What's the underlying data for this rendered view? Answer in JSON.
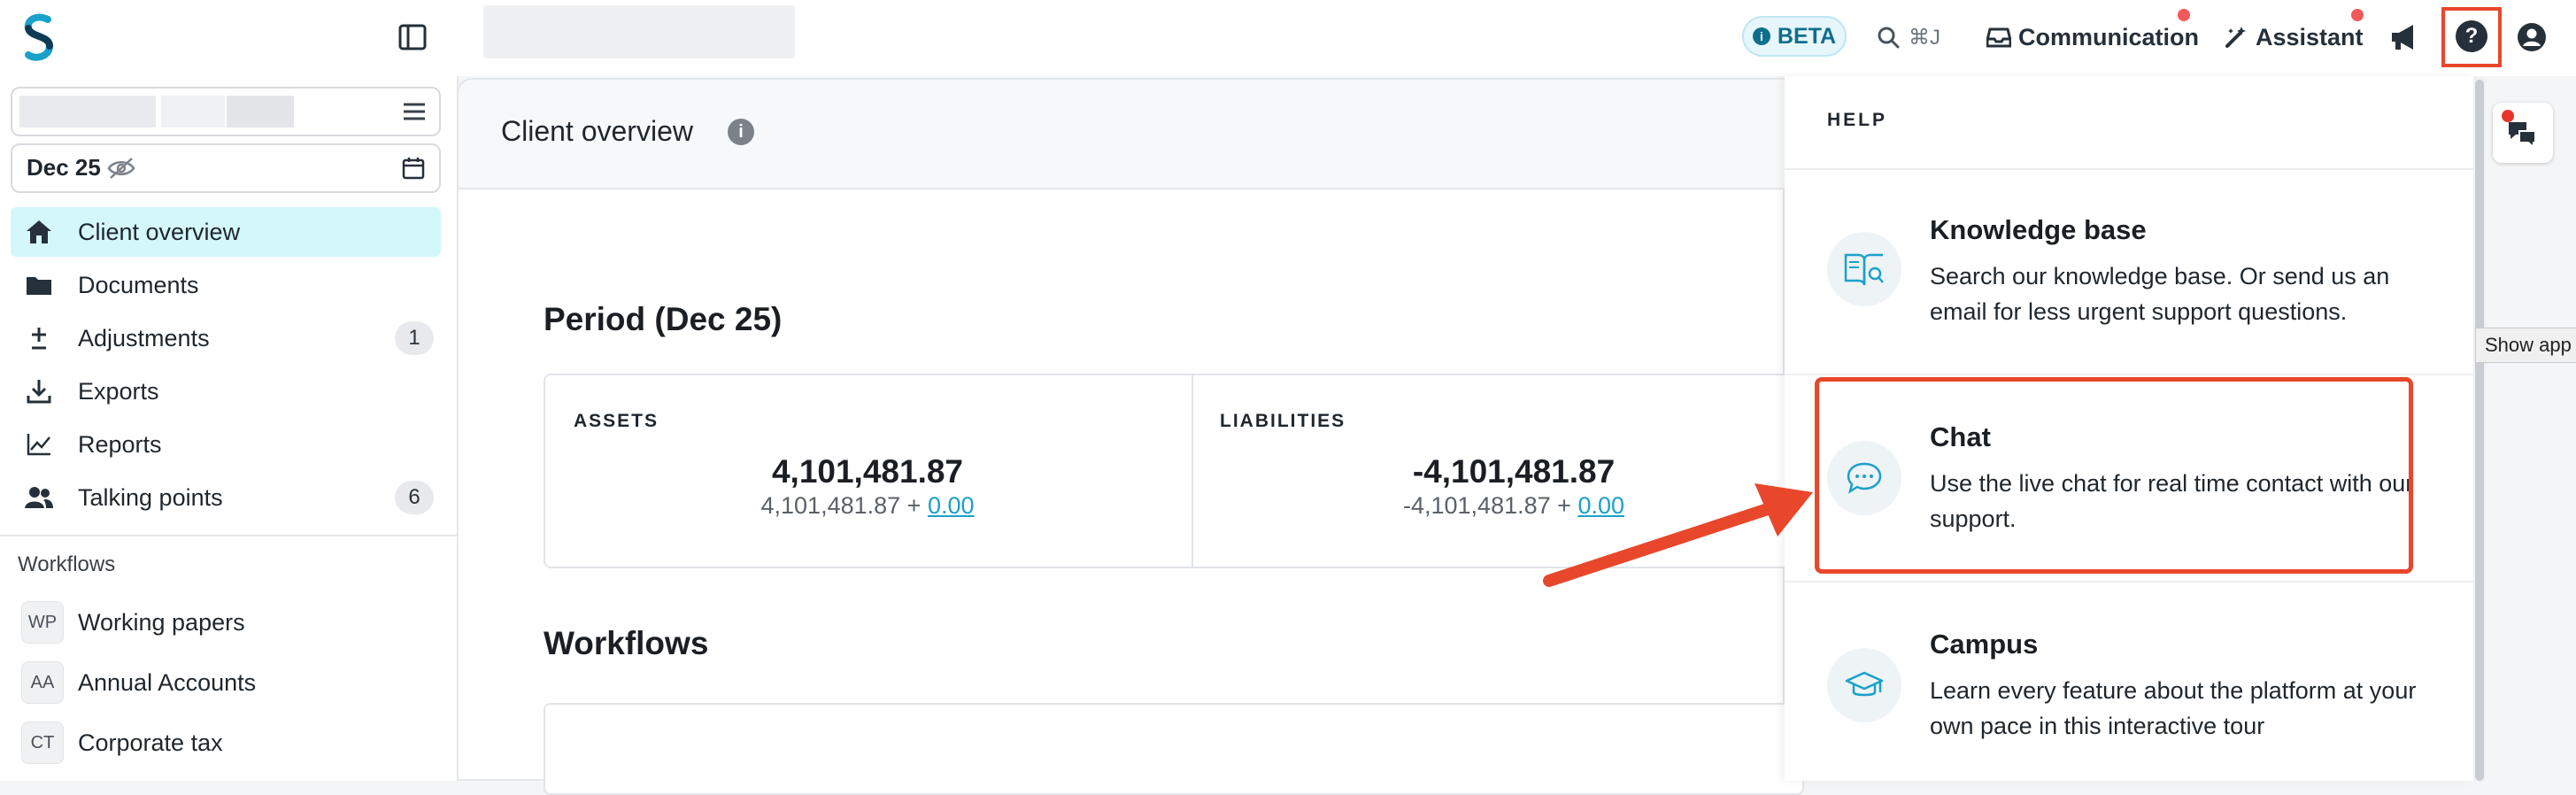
{
  "topbar": {
    "beta_label": "BETA",
    "search_shortcut": "⌘J",
    "communication_label": "Communication",
    "assistant_label": "Assistant"
  },
  "sidebar": {
    "date_label": "Dec 25",
    "nav": [
      {
        "label": "Client overview",
        "icon": "home-icon",
        "active": true
      },
      {
        "label": "Documents",
        "icon": "folder-icon"
      },
      {
        "label": "Adjustments",
        "icon": "plus-minus-icon",
        "count": "1"
      },
      {
        "label": "Exports",
        "icon": "download-icon"
      },
      {
        "label": "Reports",
        "icon": "line-chart-icon"
      },
      {
        "label": "Talking points",
        "icon": "people-icon",
        "count": "6"
      }
    ],
    "workflows_label": "Workflows",
    "workflows": [
      {
        "badge": "WP",
        "label": "Working papers"
      },
      {
        "badge": "AA",
        "label": "Annual Accounts"
      },
      {
        "badge": "CT",
        "label": "Corporate tax"
      }
    ]
  },
  "main": {
    "page_title": "Client overview",
    "period_title": "Period (Dec 25)",
    "stats": [
      {
        "label": "ASSETS",
        "value": "4,101,481.87",
        "sub_base": "4,101,481.87 +",
        "sub_link": "0.00"
      },
      {
        "label": "LIABILITIES",
        "value": "-4,101,481.87",
        "sub_base": "-4,101,481.87 +",
        "sub_link": "0.00"
      }
    ],
    "workflows_title": "Workflows"
  },
  "help": {
    "header": "HELP",
    "items": [
      {
        "title": "Knowledge base",
        "desc": "Search our knowledge base. Or send us an email for less urgent support questions.",
        "icon": "book-search-icon"
      },
      {
        "title": "Chat",
        "desc": "Use the live chat for real time contact with our support.",
        "icon": "chat-bubble-icon"
      },
      {
        "title": "Campus",
        "desc": "Learn every feature about the platform at your own pace in this interactive tour",
        "icon": "graduation-cap-icon"
      }
    ]
  },
  "tooltip": "Show app",
  "colors": {
    "accent": "#1aa1c9",
    "highlight": "#e8472b",
    "active_nav": "#d4f7fb"
  }
}
